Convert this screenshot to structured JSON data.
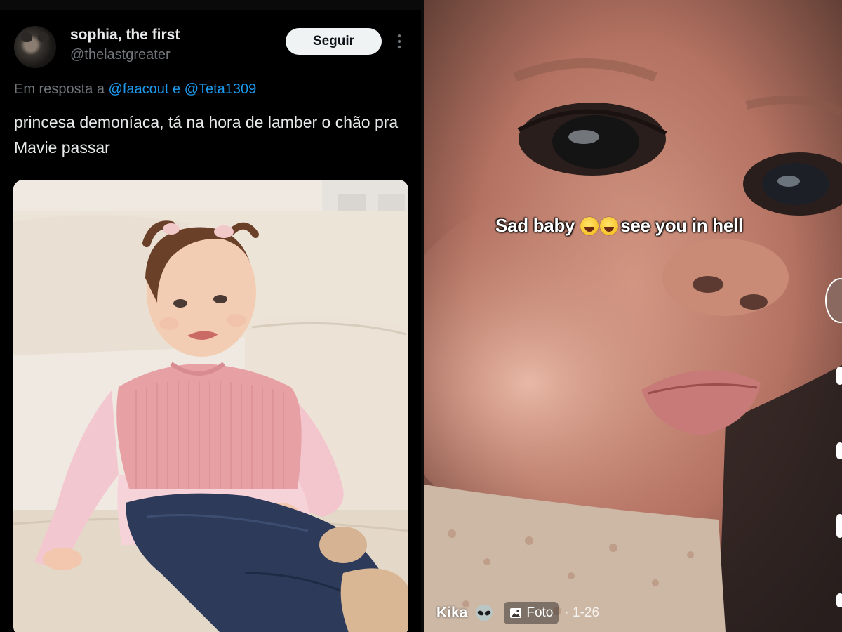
{
  "tweet": {
    "display_name": "sophia, the first",
    "handle": "@thelastgreater",
    "follow_label": "Seguir",
    "reply_prefix": "Em resposta a",
    "mention_1": "@faacout",
    "reply_joiner": "e",
    "mention_2": "@Teta1309",
    "text": "princesa demoníaca, tá na hora de lamber o chão pra Mavie passar"
  },
  "video": {
    "caption_part1": "Sad baby",
    "caption_part2": "see you in hell",
    "author": "Kika",
    "media_type_label": "Foto",
    "counter": "· 1-26"
  },
  "colors": {
    "background": "#000000",
    "text_primary": "#e7e9ea",
    "text_secondary": "#71767b",
    "link_blue": "#1d9bf0",
    "follow_button_bg": "#eff3f4"
  },
  "icons": {
    "more": "more-vertical-icon",
    "emoji_1": "laughing-tears-emoji-icon",
    "emoji_2": "crying-emoji-icon",
    "author_badge": "alien-icon",
    "media": "photo-icon"
  }
}
